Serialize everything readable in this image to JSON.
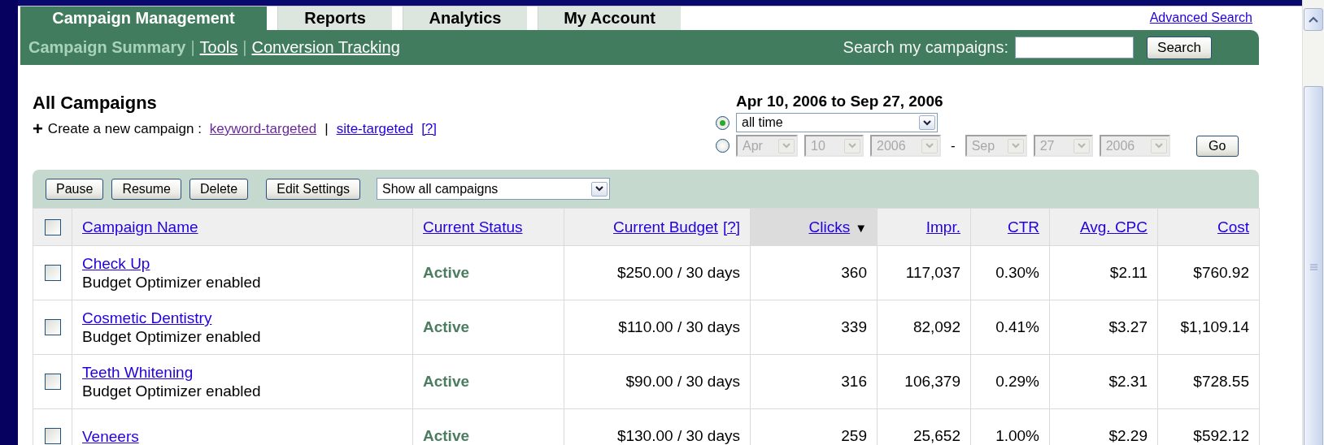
{
  "tabs": [
    {
      "label": "Campaign Management",
      "selected": true
    },
    {
      "label": "Reports",
      "selected": false
    },
    {
      "label": "Analytics",
      "selected": false
    },
    {
      "label": "My Account",
      "selected": false
    }
  ],
  "advanced_search": "Advanced Search",
  "subnav": [
    {
      "kind": "current",
      "label": "Campaign Summary"
    },
    {
      "kind": "separator",
      "label": "|"
    },
    {
      "kind": "link",
      "label": "Tools"
    },
    {
      "kind": "separator",
      "label": "|"
    },
    {
      "kind": "link",
      "label": "Conversion Tracking"
    }
  ],
  "search": {
    "label": "Search my campaigns:",
    "button": "Search"
  },
  "heading": "All Campaigns",
  "create": {
    "icon": "+",
    "label": "Create a new campaign :",
    "items": [
      {
        "kind": "link",
        "label": "keyword-targeted",
        "visited": true
      },
      {
        "kind": "separator",
        "label": "|"
      },
      {
        "kind": "link",
        "label": "site-targeted",
        "visited": false
      },
      {
        "kind": "link",
        "label": "[?]",
        "visited": false
      }
    ]
  },
  "date_range": {
    "title": "Apr 10, 2006 to Sep 27, 2006",
    "options": [
      {
        "kind": "preset",
        "selected": true,
        "value": "all time"
      },
      {
        "kind": "custom",
        "selected": false,
        "disabled": true,
        "from": [
          "Apr",
          "10",
          "2006"
        ],
        "separator": "-",
        "to": [
          "Sep",
          "27",
          "2006"
        ]
      }
    ],
    "button": "Go"
  },
  "toolbar": {
    "buttons": [
      "Pause",
      "Resume",
      "Delete",
      "Edit Settings"
    ],
    "filter": "Show all campaigns"
  },
  "table": {
    "select_all": {
      "checked": false
    },
    "columns": [
      {
        "label": "Campaign Name",
        "sorted": false
      },
      {
        "label": "Current Status",
        "sorted": false
      },
      {
        "label": "Current Budget",
        "help": "[?]",
        "sorted": false
      },
      {
        "label": "Clicks",
        "sorted": true,
        "sort_indicator": "▼"
      },
      {
        "label": "Impr.",
        "sorted": false
      },
      {
        "label": "CTR",
        "sorted": false
      },
      {
        "label": "Avg. CPC",
        "sorted": false
      },
      {
        "label": "Cost",
        "sorted": false
      }
    ],
    "rows": [
      {
        "checked": false,
        "note": "Budget Optimizer enabled",
        "cells": [
          "Check Up",
          "Active",
          "$250.00 / 30 days",
          "360",
          "117,037",
          "0.30%",
          "$2.11",
          "$760.92"
        ]
      },
      {
        "checked": false,
        "note": "Budget Optimizer enabled",
        "cells": [
          "Cosmetic Dentistry",
          "Active",
          "$110.00 / 30 days",
          "339",
          "82,092",
          "0.41%",
          "$3.27",
          "$1,109.14"
        ]
      },
      {
        "checked": false,
        "note": "Budget Optimizer enabled",
        "cells": [
          "Teeth Whitening",
          "Active",
          "$90.00 / 30 days",
          "316",
          "106,379",
          "0.29%",
          "$2.31",
          "$728.55"
        ]
      },
      {
        "checked": false,
        "cells": [
          "Veneers",
          "Active",
          "$130.00 / 30 days",
          "259",
          "25,652",
          "1.00%",
          "$2.29",
          "$592.12"
        ]
      }
    ]
  }
}
